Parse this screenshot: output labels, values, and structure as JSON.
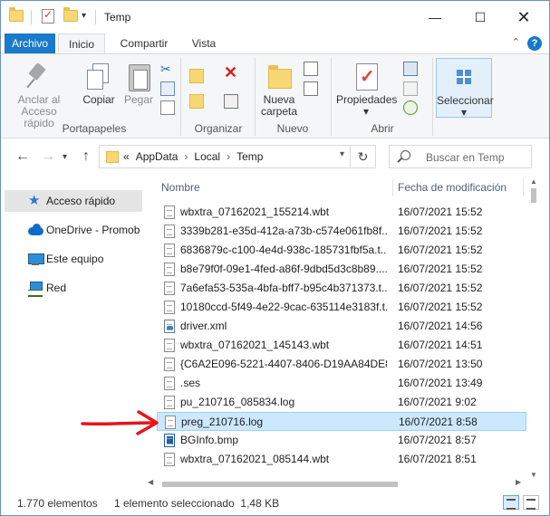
{
  "title": "Temp",
  "ribbon_tabs": [
    "Archivo",
    "Inicio",
    "Compartir",
    "Vista"
  ],
  "ribbon": {
    "portapapeles": {
      "label": "Portapapeles",
      "pin": [
        "Anclar al",
        "Acceso rápido"
      ],
      "copy": "Copiar",
      "paste": "Pegar"
    },
    "organizar": {
      "label": "Organizar"
    },
    "nuevo": {
      "label": "Nuevo",
      "new_folder": [
        "Nueva",
        "carpeta"
      ]
    },
    "abrir": {
      "label": "Abrir",
      "properties": "Propiedades"
    },
    "seleccionar": {
      "label": "Seleccionar"
    }
  },
  "address": {
    "breadcrumb": [
      "«",
      "AppData",
      "Local",
      "Temp"
    ],
    "search_placeholder": "Buscar en Temp"
  },
  "nav_pane": [
    {
      "label": "Acceso rápido",
      "icon": "star-icon"
    },
    {
      "label": "OneDrive - Promob",
      "icon": "cloud-icon"
    },
    {
      "label": "Este equipo",
      "icon": "computer-icon"
    },
    {
      "label": "Red",
      "icon": "network-icon"
    }
  ],
  "columns": {
    "name": "Nombre",
    "date": "Fecha de modificación"
  },
  "files": [
    {
      "name": "wbxtra_07162021_155214.wbt",
      "date": "16/07/2021 15:52",
      "type": "file"
    },
    {
      "name": "3339b281-e35d-412a-a73b-c574e061fb8f....",
      "date": "16/07/2021 15:52",
      "type": "file"
    },
    {
      "name": "6836879c-c100-4e4d-938c-185731fbf5a.t...",
      "date": "16/07/2021 15:52",
      "type": "file"
    },
    {
      "name": "b8e79f0f-09e1-4fed-a86f-9dbd5d3c8b89....",
      "date": "16/07/2021 15:52",
      "type": "file"
    },
    {
      "name": "7a6efa53-535a-4bfa-bff7-b95c4b371373.t...",
      "date": "16/07/2021 15:52",
      "type": "file"
    },
    {
      "name": "10180ccd-5f49-4e22-9cac-635114e3183f.t...",
      "date": "16/07/2021 15:52",
      "type": "file"
    },
    {
      "name": "driver.xml",
      "date": "16/07/2021 14:56",
      "type": "xml"
    },
    {
      "name": "wbxtra_07162021_145143.wbt",
      "date": "16/07/2021 14:51",
      "type": "file"
    },
    {
      "name": "{C6A2E096-5221-4407-8406-D19AA84DE8...",
      "date": "16/07/2021 13:50",
      "type": "file"
    },
    {
      "name": ".ses",
      "date": "16/07/2021 13:49",
      "type": "file"
    },
    {
      "name": "pu_210716_085834.log",
      "date": "16/07/2021 9:02",
      "type": "file"
    },
    {
      "name": "preg_210716.log",
      "date": "16/07/2021 8:58",
      "type": "file",
      "selected": true
    },
    {
      "name": "BGInfo.bmp",
      "date": "16/07/2021 8:57",
      "type": "bmp"
    },
    {
      "name": "wbxtra_07162021_085144.wbt",
      "date": "16/07/2021 8:51",
      "type": "file"
    }
  ],
  "status": {
    "count": "1.770 elementos",
    "selection": "1 elemento seleccionado  1,48 KB"
  },
  "colors": {
    "file_tab": "#1979ca",
    "selection_bg": "#cce8ff",
    "annotation_arrow": "#e8141b"
  }
}
